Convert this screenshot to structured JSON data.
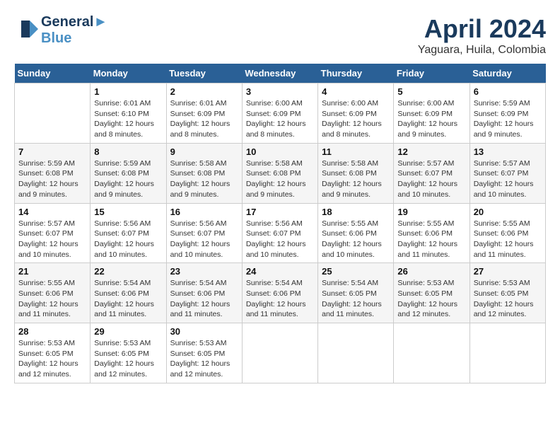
{
  "header": {
    "logo_line1": "General",
    "logo_line2": "Blue",
    "month": "April 2024",
    "location": "Yaguara, Huila, Colombia"
  },
  "days_of_week": [
    "Sunday",
    "Monday",
    "Tuesday",
    "Wednesday",
    "Thursday",
    "Friday",
    "Saturday"
  ],
  "weeks": [
    [
      {
        "num": "",
        "info": ""
      },
      {
        "num": "1",
        "info": "Sunrise: 6:01 AM\nSunset: 6:10 PM\nDaylight: 12 hours\nand 8 minutes."
      },
      {
        "num": "2",
        "info": "Sunrise: 6:01 AM\nSunset: 6:09 PM\nDaylight: 12 hours\nand 8 minutes."
      },
      {
        "num": "3",
        "info": "Sunrise: 6:00 AM\nSunset: 6:09 PM\nDaylight: 12 hours\nand 8 minutes."
      },
      {
        "num": "4",
        "info": "Sunrise: 6:00 AM\nSunset: 6:09 PM\nDaylight: 12 hours\nand 8 minutes."
      },
      {
        "num": "5",
        "info": "Sunrise: 6:00 AM\nSunset: 6:09 PM\nDaylight: 12 hours\nand 9 minutes."
      },
      {
        "num": "6",
        "info": "Sunrise: 5:59 AM\nSunset: 6:09 PM\nDaylight: 12 hours\nand 9 minutes."
      }
    ],
    [
      {
        "num": "7",
        "info": "Sunrise: 5:59 AM\nSunset: 6:08 PM\nDaylight: 12 hours\nand 9 minutes."
      },
      {
        "num": "8",
        "info": "Sunrise: 5:59 AM\nSunset: 6:08 PM\nDaylight: 12 hours\nand 9 minutes."
      },
      {
        "num": "9",
        "info": "Sunrise: 5:58 AM\nSunset: 6:08 PM\nDaylight: 12 hours\nand 9 minutes."
      },
      {
        "num": "10",
        "info": "Sunrise: 5:58 AM\nSunset: 6:08 PM\nDaylight: 12 hours\nand 9 minutes."
      },
      {
        "num": "11",
        "info": "Sunrise: 5:58 AM\nSunset: 6:08 PM\nDaylight: 12 hours\nand 9 minutes."
      },
      {
        "num": "12",
        "info": "Sunrise: 5:57 AM\nSunset: 6:07 PM\nDaylight: 12 hours\nand 10 minutes."
      },
      {
        "num": "13",
        "info": "Sunrise: 5:57 AM\nSunset: 6:07 PM\nDaylight: 12 hours\nand 10 minutes."
      }
    ],
    [
      {
        "num": "14",
        "info": "Sunrise: 5:57 AM\nSunset: 6:07 PM\nDaylight: 12 hours\nand 10 minutes."
      },
      {
        "num": "15",
        "info": "Sunrise: 5:56 AM\nSunset: 6:07 PM\nDaylight: 12 hours\nand 10 minutes."
      },
      {
        "num": "16",
        "info": "Sunrise: 5:56 AM\nSunset: 6:07 PM\nDaylight: 12 hours\nand 10 minutes."
      },
      {
        "num": "17",
        "info": "Sunrise: 5:56 AM\nSunset: 6:07 PM\nDaylight: 12 hours\nand 10 minutes."
      },
      {
        "num": "18",
        "info": "Sunrise: 5:55 AM\nSunset: 6:06 PM\nDaylight: 12 hours\nand 10 minutes."
      },
      {
        "num": "19",
        "info": "Sunrise: 5:55 AM\nSunset: 6:06 PM\nDaylight: 12 hours\nand 11 minutes."
      },
      {
        "num": "20",
        "info": "Sunrise: 5:55 AM\nSunset: 6:06 PM\nDaylight: 12 hours\nand 11 minutes."
      }
    ],
    [
      {
        "num": "21",
        "info": "Sunrise: 5:55 AM\nSunset: 6:06 PM\nDaylight: 12 hours\nand 11 minutes."
      },
      {
        "num": "22",
        "info": "Sunrise: 5:54 AM\nSunset: 6:06 PM\nDaylight: 12 hours\nand 11 minutes."
      },
      {
        "num": "23",
        "info": "Sunrise: 5:54 AM\nSunset: 6:06 PM\nDaylight: 12 hours\nand 11 minutes."
      },
      {
        "num": "24",
        "info": "Sunrise: 5:54 AM\nSunset: 6:06 PM\nDaylight: 12 hours\nand 11 minutes."
      },
      {
        "num": "25",
        "info": "Sunrise: 5:54 AM\nSunset: 6:05 PM\nDaylight: 12 hours\nand 11 minutes."
      },
      {
        "num": "26",
        "info": "Sunrise: 5:53 AM\nSunset: 6:05 PM\nDaylight: 12 hours\nand 12 minutes."
      },
      {
        "num": "27",
        "info": "Sunrise: 5:53 AM\nSunset: 6:05 PM\nDaylight: 12 hours\nand 12 minutes."
      }
    ],
    [
      {
        "num": "28",
        "info": "Sunrise: 5:53 AM\nSunset: 6:05 PM\nDaylight: 12 hours\nand 12 minutes."
      },
      {
        "num": "29",
        "info": "Sunrise: 5:53 AM\nSunset: 6:05 PM\nDaylight: 12 hours\nand 12 minutes."
      },
      {
        "num": "30",
        "info": "Sunrise: 5:53 AM\nSunset: 6:05 PM\nDaylight: 12 hours\nand 12 minutes."
      },
      {
        "num": "",
        "info": ""
      },
      {
        "num": "",
        "info": ""
      },
      {
        "num": "",
        "info": ""
      },
      {
        "num": "",
        "info": ""
      }
    ]
  ]
}
